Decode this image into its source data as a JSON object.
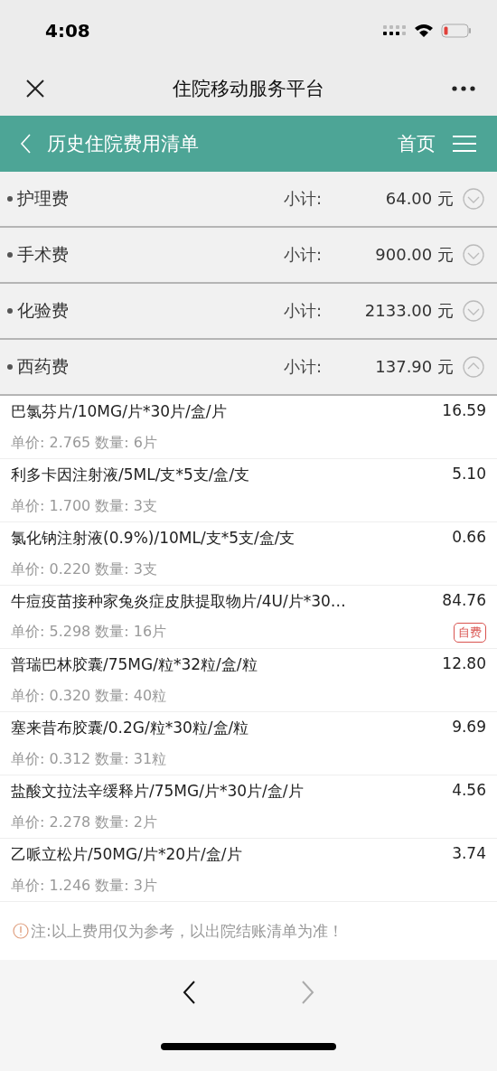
{
  "status_bar": {
    "time": "4:08"
  },
  "nav_bar": {
    "title": "住院移动服务平台"
  },
  "header": {
    "title": "历史住院费用清单",
    "home_link": "首页"
  },
  "categories": [
    {
      "name": "护理费",
      "subtotal_label": "小计:",
      "amount": "64.00 元",
      "expanded": false
    },
    {
      "name": "手术费",
      "subtotal_label": "小计:",
      "amount": "900.00 元",
      "expanded": false
    },
    {
      "name": "化验费",
      "subtotal_label": "小计:",
      "amount": "2133.00 元",
      "expanded": false
    },
    {
      "name": "西药费",
      "subtotal_label": "小计:",
      "amount": "137.90 元",
      "expanded": true,
      "items": [
        {
          "name": "巴氯芬片/10MG/片*30片/盒/片",
          "total": "16.59",
          "detail": "单价: 2.765 数量: 6片"
        },
        {
          "name": "利多卡因注射液/5ML/支*5支/盒/支",
          "total": "5.10",
          "detail": "单价: 1.700 数量: 3支"
        },
        {
          "name": "氯化钠注射液(0.9%)/10ML/支*5支/盒/支",
          "total": "0.66",
          "detail": "单价: 0.220 数量: 3支"
        },
        {
          "name": "牛痘疫苗接种家兔炎症皮肤提取物片/4U/片*30…",
          "total": "84.76",
          "detail": "单价: 5.298 数量: 16片",
          "badge": "自费"
        },
        {
          "name": "普瑞巴林胶囊/75MG/粒*32粒/盒/粒",
          "total": "12.80",
          "detail": "单价: 0.320 数量: 40粒"
        },
        {
          "name": "塞来昔布胶囊/0.2G/粒*30粒/盒/粒",
          "total": "9.69",
          "detail": "单价: 0.312 数量: 31粒"
        },
        {
          "name": "盐酸文拉法辛缓释片/75MG/片*30片/盒/片",
          "total": "4.56",
          "detail": "单价: 2.278 数量: 2片"
        },
        {
          "name": "乙哌立松片/50MG/片*20片/盒/片",
          "total": "3.74",
          "detail": "单价: 1.246 数量: 3片"
        }
      ]
    }
  ],
  "note": "注:以上费用仅为参考，以出院结账清单为准！",
  "browser_nav": {
    "back_disabled": false,
    "forward_disabled": true
  }
}
